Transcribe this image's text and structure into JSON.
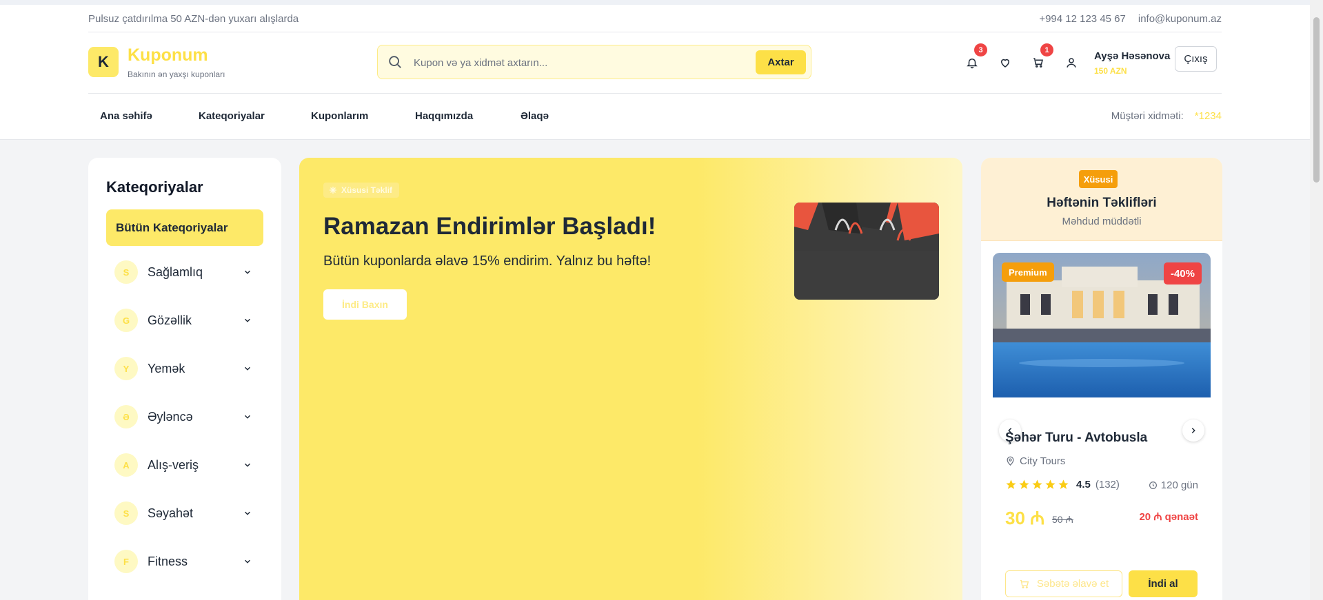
{
  "topbar": {
    "promo": "Pulsuz çatdırılma 50 AZN-dən yuxarı alışlarda",
    "phone": "+994 12 123 45 67",
    "email": "info@kuponum.az"
  },
  "brand": {
    "logo_letter": "K",
    "name": "Kuponum",
    "tagline": "Bakının ən yaxşı kuponları"
  },
  "search": {
    "placeholder": "Kupon və ya xidmət axtarın...",
    "button": "Axtar"
  },
  "header_icons": {
    "notifications_count": "3",
    "cart_count": "1"
  },
  "user": {
    "name": "Ayşə Həsənova",
    "balance": "150 AZN",
    "logout": "Çıxış"
  },
  "nav": {
    "items": [
      {
        "label": "Ana səhifə"
      },
      {
        "label": "Kateqoriyalar"
      },
      {
        "label": "Kuponlarım"
      },
      {
        "label": "Haqqımızda"
      },
      {
        "label": "Əlaqə"
      }
    ],
    "support_label": "Müştəri xidməti:",
    "support_number": "*1234"
  },
  "sidebar": {
    "title": "Kateqoriyalar",
    "all_label": "Bütün Kateqoriyalar",
    "items": [
      {
        "initial": "S",
        "label": "Sağlamlıq"
      },
      {
        "initial": "G",
        "label": "Gözəllik"
      },
      {
        "initial": "Y",
        "label": "Yemək"
      },
      {
        "initial": "Ə",
        "label": "Əyləncə"
      },
      {
        "initial": "A",
        "label": "Alış-veriş"
      },
      {
        "initial": "S",
        "label": "Səyahət"
      },
      {
        "initial": "F",
        "label": "Fitness"
      }
    ]
  },
  "hero": {
    "tag": "Xüsusi Təklif",
    "title": "Ramazan Endirimlər Başladı!",
    "subtitle": "Bütün kuponlarda əlavə 15% endirim. Yalnız bu həftə!",
    "cta": "İndi Baxın"
  },
  "deals": {
    "badge": "Xüsusi",
    "title": "Həftənin Təklifləri",
    "subtitle": "Məhdud müddətli",
    "card": {
      "premium": "Premium",
      "discount": "-40%",
      "title": "Şəhər Turu - Avtobusla",
      "location": "City Tours",
      "rating": "4.5",
      "reviews": "(132)",
      "stars": 5,
      "duration": "120 gün",
      "price": "30 ₼",
      "old_price": "50 ₼",
      "saving": "20 ₼ qənaət",
      "add_to_cart": "Səbətə əlavə et",
      "buy_now": "İndi al"
    }
  },
  "colors": {
    "accent": "#fde047",
    "accent_light": "#fde968",
    "danger": "#ef4444",
    "orange": "#f59e0b"
  }
}
